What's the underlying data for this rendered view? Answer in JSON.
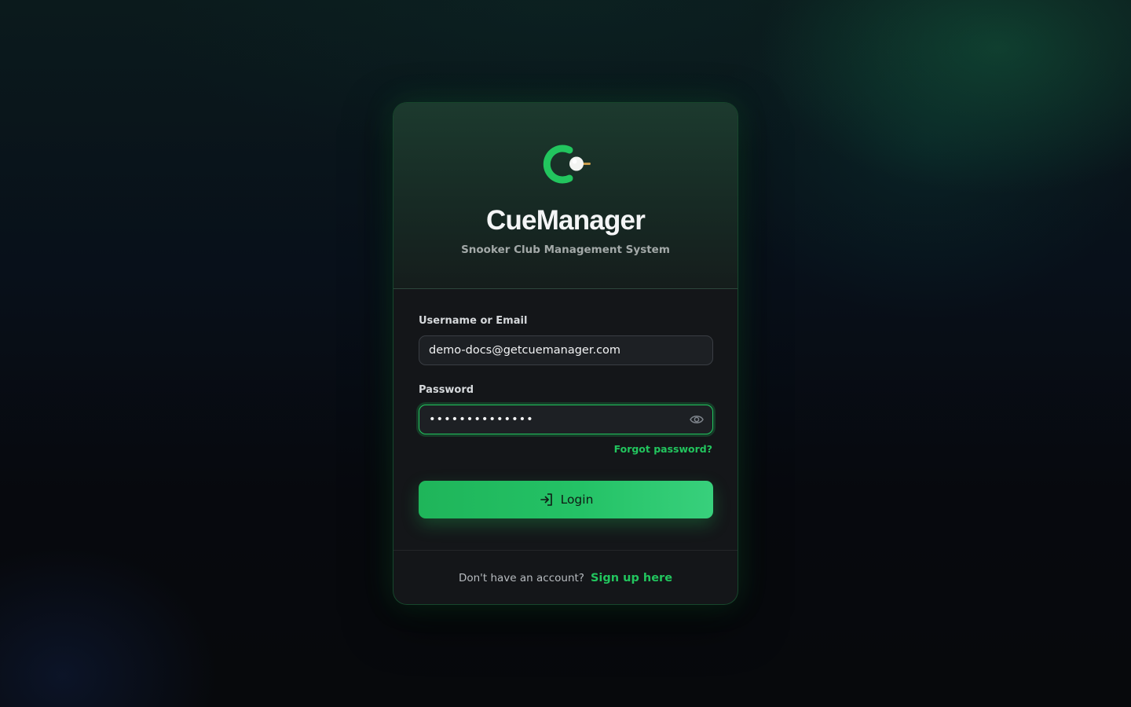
{
  "brand": {
    "name": "CueManager",
    "tagline": "Snooker Club Management System",
    "accent_color": "#22c55e",
    "logo_icon": "cue-c-logo-icon"
  },
  "form": {
    "username_label": "Username or Email",
    "username_value": "demo-docs@getcuemanager.com",
    "password_label": "Password",
    "password_value": "••••••••••••••",
    "password_toggle_icon": "eye-icon",
    "forgot_link": "Forgot password?",
    "login_label": "Login",
    "login_icon": "sign-in-icon"
  },
  "footer": {
    "prompt": "Don't have an account?",
    "signup_link": "Sign up here"
  }
}
